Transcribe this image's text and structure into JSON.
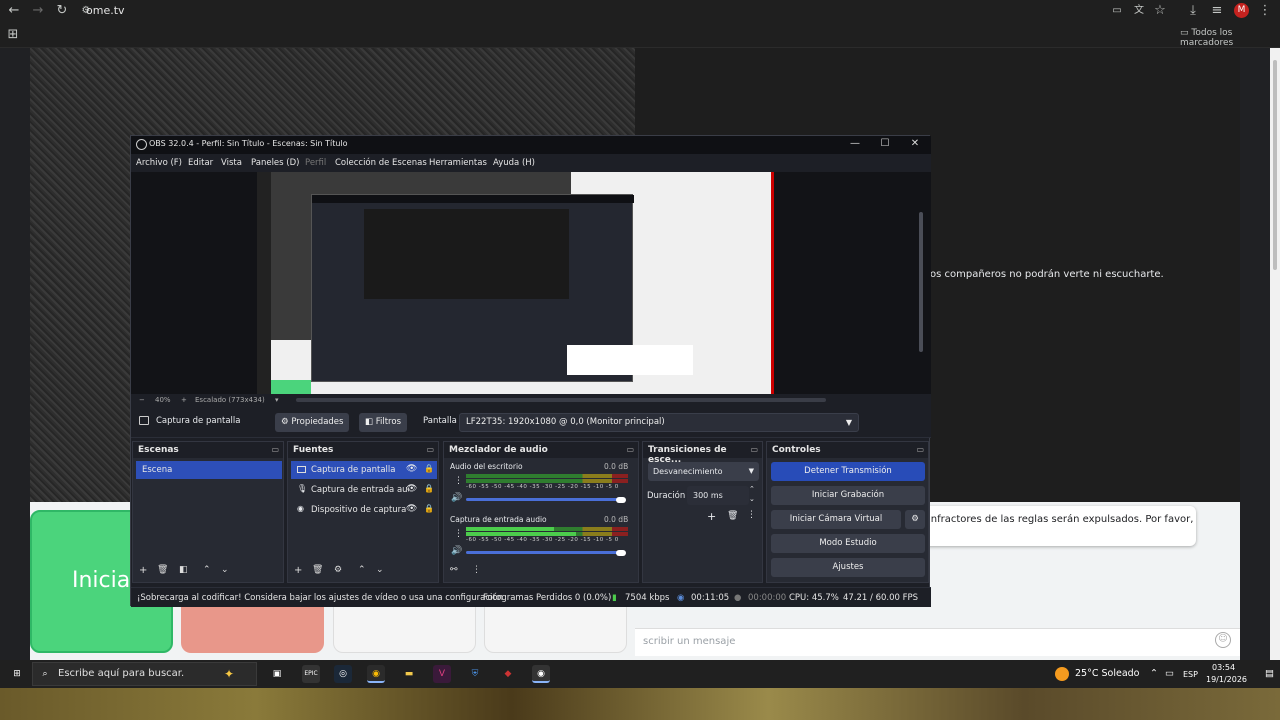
{
  "browser": {
    "url": "ome.tv",
    "bookmarks_label": "Todos los marcadores",
    "profile_initial": "M"
  },
  "page": {
    "stranger_text": "os compañeros no podrán verte ni escucharte.",
    "chat_text": "infractores de las reglas serán expulsados. Por favor,",
    "message_placeholder": "scribir un mensaje",
    "start_label": "Iniciar"
  },
  "obs": {
    "title": "OBS 32.0.4 - Perfil: Sin Título - Escenas: Sin Título",
    "menu": [
      "Archivo (F)",
      "Editar",
      "Vista",
      "Paneles (D)",
      "Perfil",
      "Colección de Escenas",
      "Herramientas",
      "Ayuda (H)"
    ],
    "zoom": "40%",
    "scaling": "Escalado (773x434)",
    "source_bar": {
      "source_name": "Captura de pantalla",
      "properties": "Propiedades",
      "filters": "Filtros",
      "display_label": "Pantalla",
      "display_value": "LF22T35: 1920x1080 @ 0,0 (Monitor principal)"
    },
    "scenes": {
      "title": "Escenas",
      "items": [
        "Escena"
      ]
    },
    "sources": {
      "title": "Fuentes",
      "items": [
        "Captura de pantalla",
        "Captura de entrada aud",
        "Dispositivo de captura"
      ]
    },
    "mixer": {
      "title": "Mezclador de audio",
      "channels": [
        {
          "name": "Audio del escritorio",
          "db": "0.0 dB"
        },
        {
          "name": "Captura de entrada audio",
          "db": "0.0 dB"
        }
      ],
      "scale": "-60 -55 -50 -45 -40 -35 -30 -25 -20 -15 -10 -5 0"
    },
    "transitions": {
      "title": "Transiciones de esce...",
      "selected": "Desvanecimiento",
      "duration_label": "Duración",
      "duration_value": "300 ms"
    },
    "controls": {
      "title": "Controles",
      "buttons": [
        "Detener Transmisión",
        "Iniciar Grabación",
        "Iniciar Cámara Virtual",
        "Modo Estudio",
        "Ajustes"
      ]
    },
    "status": {
      "warning": "¡Sobrecarga al codificar! Considera bajar los ajustes de vídeo o usa una configuración",
      "dropped": "Fotogramas Perdidos 0 (0.0%)",
      "bitrate": "7504 kbps",
      "stream_time": "00:11:05",
      "rec_time": "00:00:00",
      "cpu": "CPU: 45.7%",
      "fps": "47.21 / 60.00 FPS"
    }
  },
  "taskbar": {
    "search_placeholder": "Escribe aquí para buscar.",
    "weather": "25°C  Soleado",
    "lang": "ESP",
    "time": "03:54",
    "date": "19/1/2026"
  },
  "colors": {
    "accent": "#2d4fb8",
    "obs_bg": "#1d1f26",
    "live_green": "#4bd47c"
  }
}
